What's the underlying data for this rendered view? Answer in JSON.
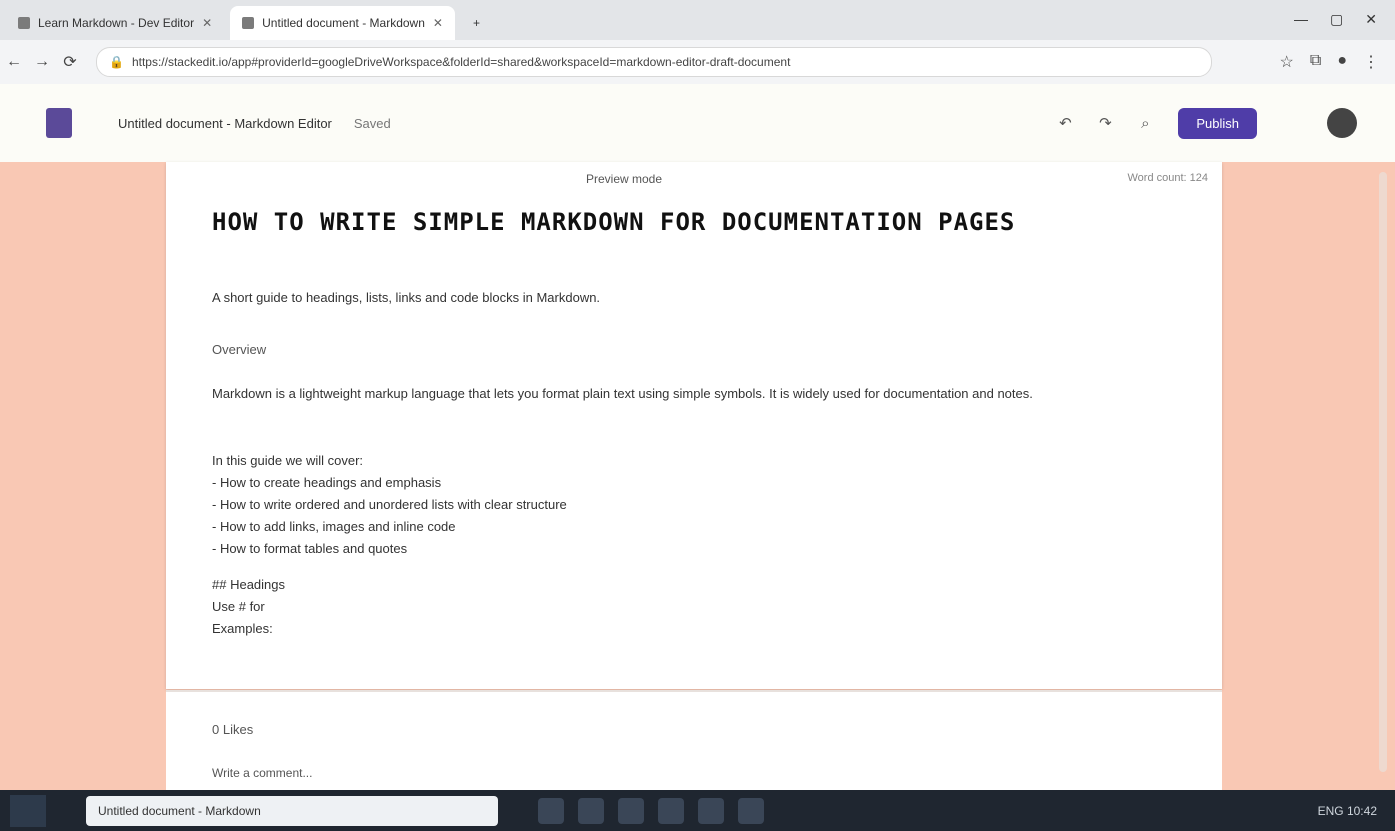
{
  "browser": {
    "tabs": [
      {
        "title": "Learn Markdown - Dev Editor",
        "active": false
      },
      {
        "title": "Untitled document - Markdown",
        "active": true
      }
    ],
    "new_tab": "+",
    "window_controls": [
      "—",
      "▢",
      "✕"
    ],
    "address": "https://stackedit.io/app#providerId=googleDriveWorkspace&folderId=shared&workspaceId=markdown-editor-draft-document",
    "toolbar_icons": [
      "star-icon",
      "extensions-icon",
      "profile-icon",
      "menu-icon"
    ]
  },
  "app": {
    "logo_icon": "document-icon",
    "doc_title": "Untitled document - Markdown Editor",
    "doc_meta": "Saved",
    "header_icons": [
      "undo-icon",
      "redo-icon",
      "search-icon"
    ],
    "share_label": "Publish",
    "avatar_label": ""
  },
  "editor": {
    "top_status": "Preview mode",
    "top_right": "Word count: 124",
    "heading": "HOW TO WRITE SIMPLE MARKDOWN FOR DOCUMENTATION PAGES",
    "subtitle": "A short guide to headings, lists, links and code blocks in Markdown.",
    "section_label": "Overview",
    "paragraph": "Markdown is a lightweight markup language that lets you format plain text using simple symbols. It is widely used for documentation and notes.",
    "list_intro": "In this guide we will cover:",
    "list_items": [
      "- How to create headings and emphasis",
      "- How to write ordered and unordered lists with clear structure",
      "- How to add links, images and inline code",
      "- How to format tables and quotes"
    ],
    "tail_lines": [
      "## Headings",
      "Use # for",
      "Examples:"
    ]
  },
  "comments": {
    "count_label": "0  Likes",
    "input_placeholder": "Write a comment..."
  },
  "taskbar": {
    "active_label": "Untitled document - Markdown",
    "tray_text": "ENG  10:42"
  },
  "colors": {
    "accent": "#4f3da8",
    "workspace_bg": "#f9c8b4",
    "taskbar": "#1f2630"
  }
}
